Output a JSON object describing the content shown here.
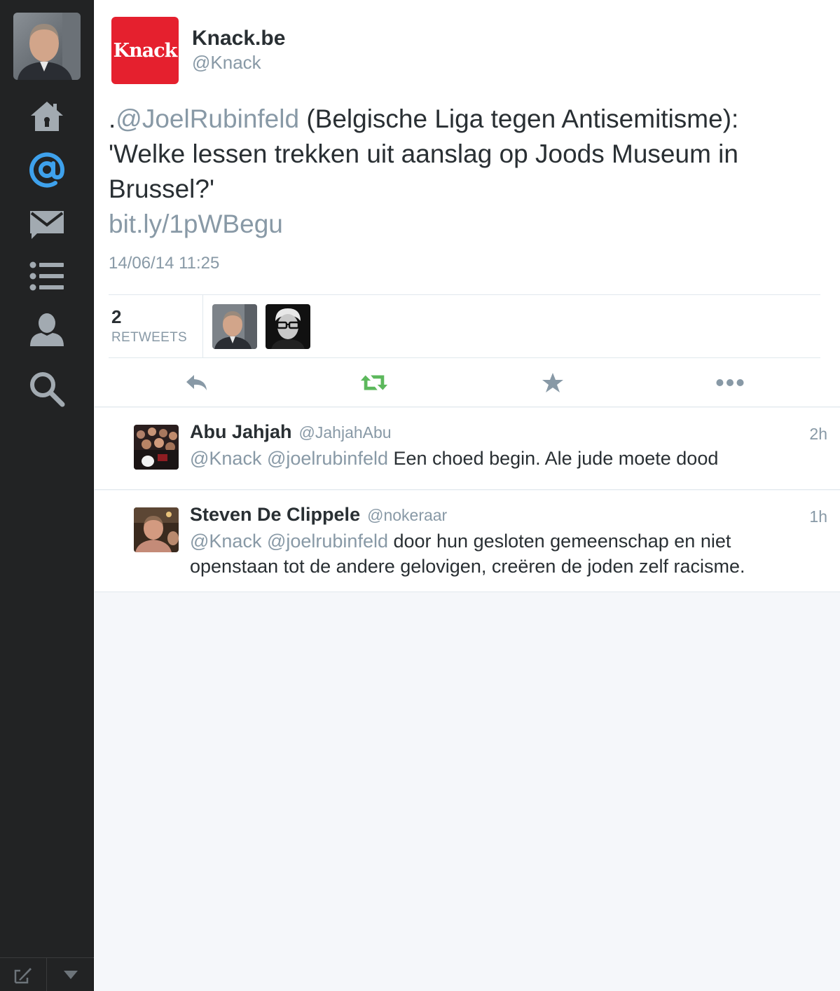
{
  "sidebar": {
    "nav": [
      {
        "name": "home-icon",
        "icon": "home"
      },
      {
        "name": "mentions-icon",
        "icon": "at-sign",
        "active": true
      },
      {
        "name": "messages-icon",
        "icon": "envelope"
      },
      {
        "name": "lists-icon",
        "icon": "list"
      },
      {
        "name": "profile-icon",
        "icon": "person"
      },
      {
        "name": "search-icon",
        "icon": "magnifier"
      }
    ],
    "bottom": [
      "compose-icon",
      "dropdown-arrow-icon"
    ],
    "active_color": "#3ea1ec"
  },
  "tweet": {
    "logo_text": "Knack",
    "author_name": "Knack.be",
    "author_handle": "@Knack",
    "text_prefix": ".",
    "text_mention": "@JoelRubinfeld",
    "text_body": " (Belgische Liga tegen Antisemitisme): 'Welke lessen trekken uit aanslag op Joods Museum in Brussel?'",
    "link": "bit.ly/1pWBegu",
    "timestamp": "14/06/14 11:25",
    "retweet_count": "2",
    "retweet_label": "RETWEETS",
    "brand_color": "#e5202e",
    "retweet_color": "#5cb85c"
  },
  "replies": [
    {
      "name": "Abu Jahjah",
      "handle": "@JahjahAbu",
      "time": "2h",
      "mention1": "@Knack",
      "mention2": "@joelrubinfeld",
      "text": " Een choed begin. Ale jude moete dood"
    },
    {
      "name": "Steven De Clippele",
      "handle": "@nokeraar",
      "time": "1h",
      "mention1": "@Knack",
      "mention2": "@joelrubinfeld",
      "text": " door hun gesloten gemeenschap en niet openstaan tot de andere gelovigen, creëren de joden zelf racisme."
    }
  ]
}
